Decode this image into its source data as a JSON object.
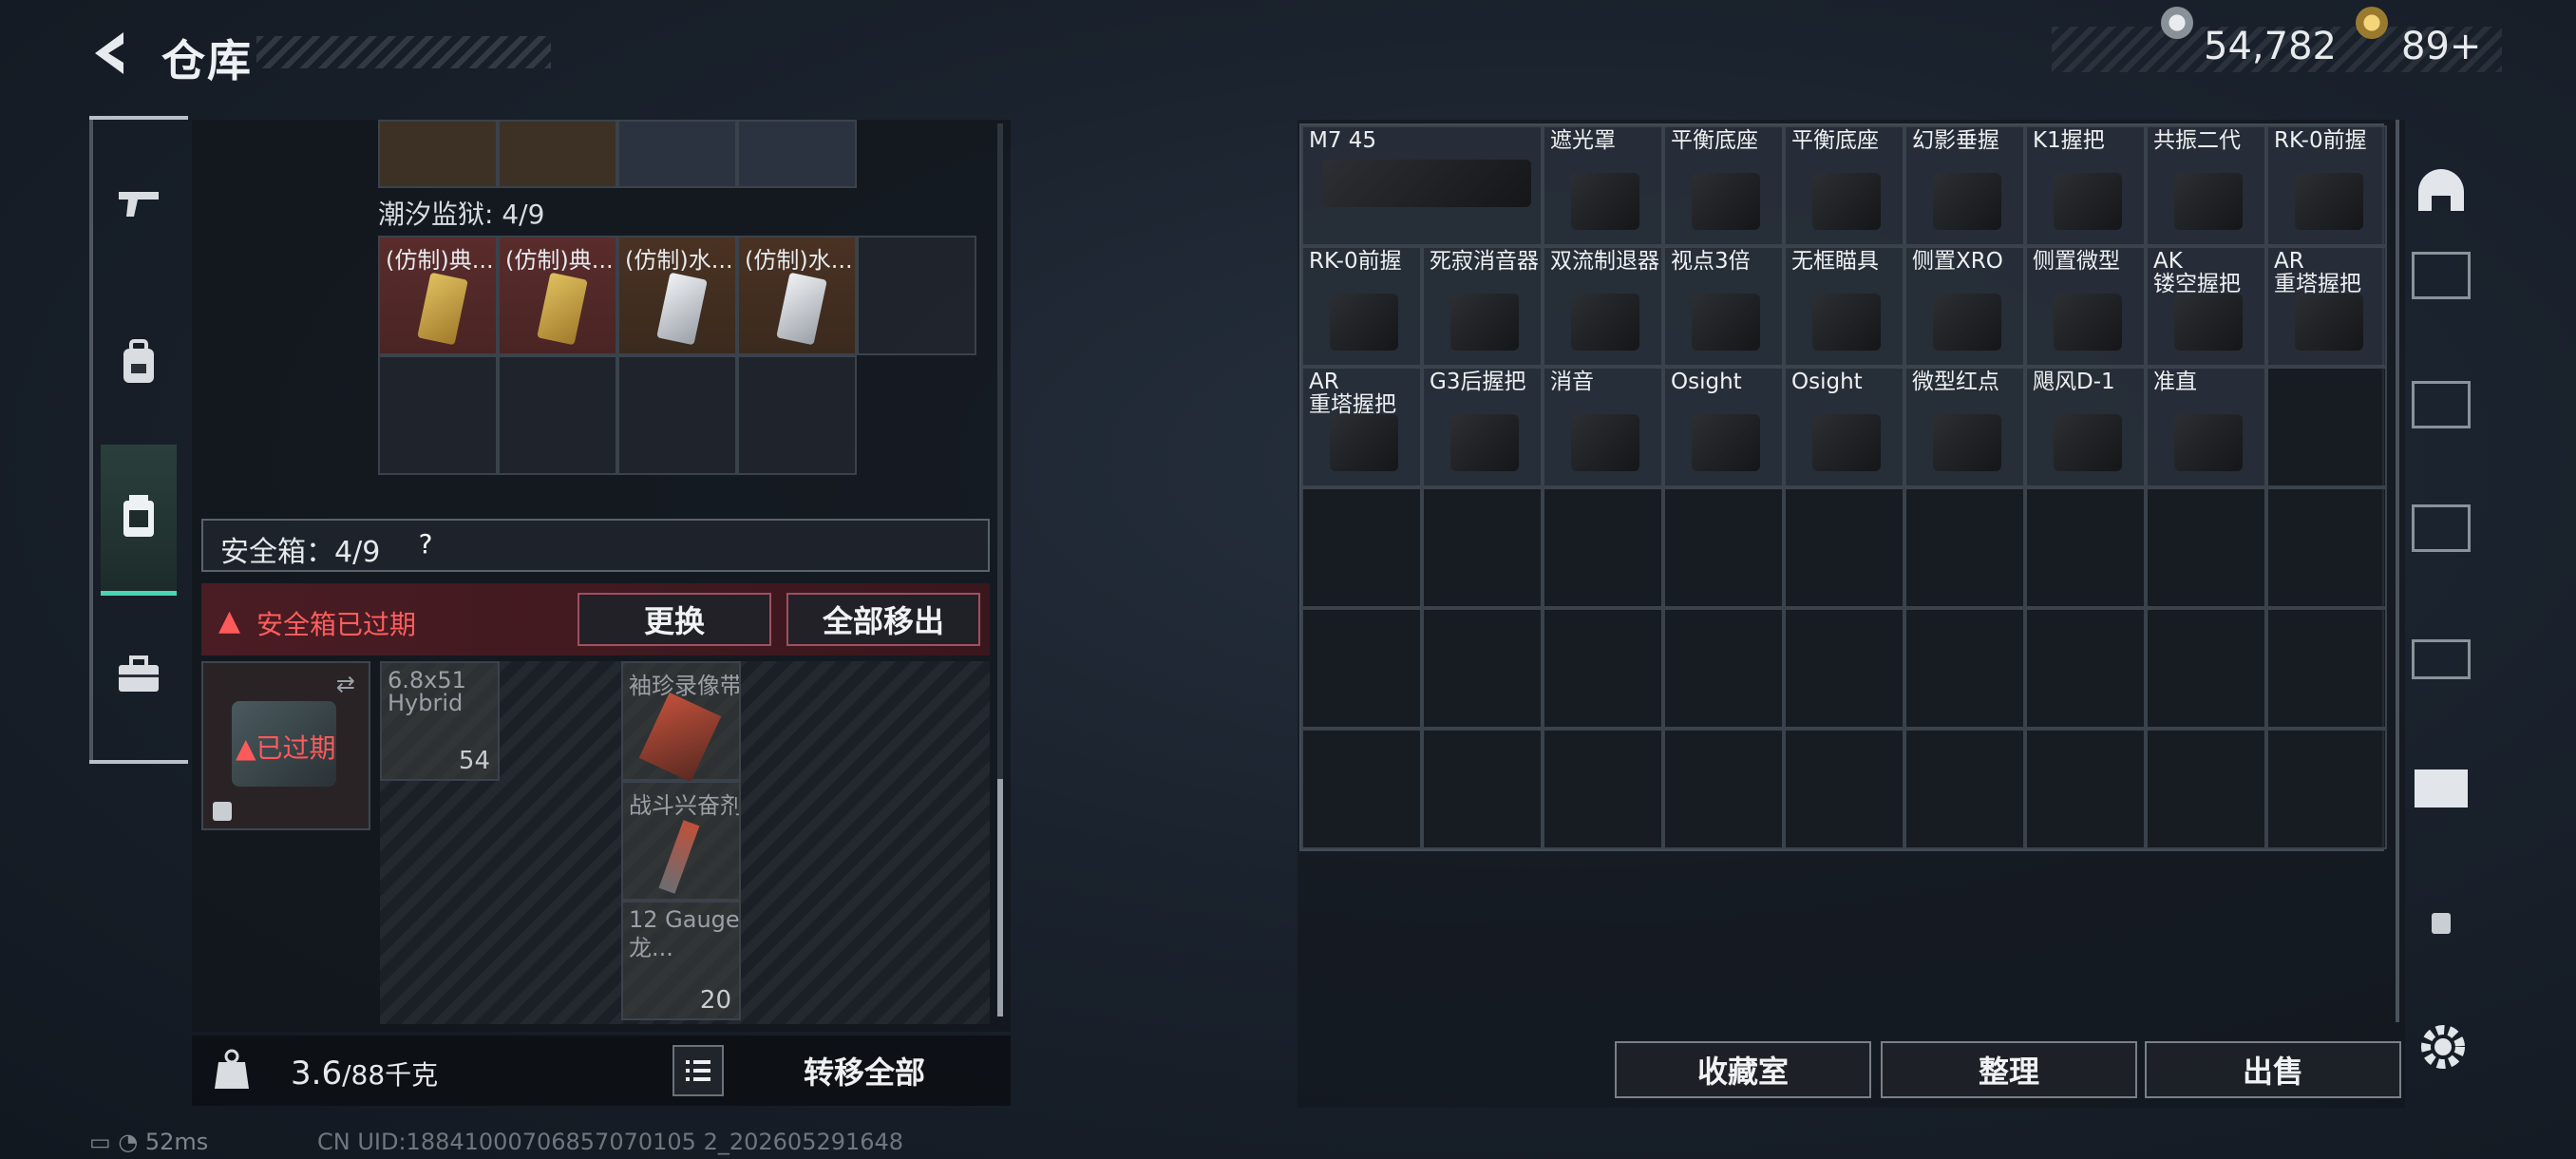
{
  "header": {
    "back_icon": "back-arrow-icon",
    "title": "仓库",
    "currency1": "54,782",
    "currency2": "89+"
  },
  "nav": [
    {
      "name": "weapon",
      "icon": "gun-icon"
    },
    {
      "name": "gear",
      "icon": "backpack-icon"
    },
    {
      "name": "container",
      "icon": "safebox-icon",
      "active": true
    },
    {
      "name": "briefcase",
      "icon": "briefcase-icon"
    }
  ],
  "left": {
    "tide_prison_label": "潮汐监狱: 4/9",
    "prison_items": [
      "(仿制)典...",
      "(仿制)典...",
      "(仿制)水...",
      "(仿制)水..."
    ],
    "safebox_label": "安全箱：4/9",
    "safebox_help": "?",
    "expired_notice": "安全箱已过期",
    "replace_button": "更换",
    "move_all_button": "全部移出",
    "case_expired": "已过期",
    "safe_items": [
      {
        "label": "6.8x51",
        "label2": "Hybrid",
        "count": "54"
      },
      {
        "label": "袖珍录像带",
        "count": ""
      },
      {
        "label": "战斗兴奋剂",
        "count": ""
      },
      {
        "label": "12 Gauge",
        "label2": "龙...",
        "count": "20"
      }
    ],
    "weight_value": "3.6",
    "weight_total": "/88千克",
    "transfer_all": "转移全部"
  },
  "right": {
    "items": [
      "M7 45",
      "遮光罩",
      "平衡底座",
      "平衡底座",
      "幻影垂握",
      "K1握把",
      "共振二代",
      "RK-0前握",
      "RK-0前握",
      "死寂消音器",
      "双流制退器",
      "视点3倍",
      "无框瞄具",
      "侧置XRO",
      "侧置微型",
      "AK\n镂空握把",
      "AR\n重塔握把",
      "AR\n重塔握把",
      "G3后握把",
      "消音",
      "Osight",
      "Osight",
      "微型红点",
      "飓风D-1",
      "准直"
    ],
    "collection_button": "收藏室",
    "tidy_button": "整理",
    "sell_button": "出售"
  },
  "status": {
    "ping": "52ms",
    "uid": "CN UID:18841000706857070105 2_202605291648"
  }
}
